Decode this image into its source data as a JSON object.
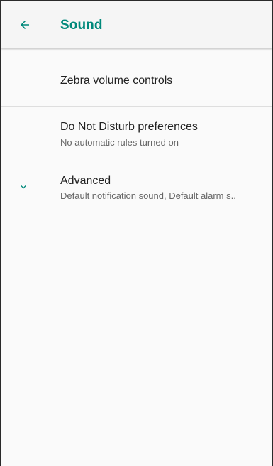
{
  "app_bar": {
    "title": "Sound",
    "back_icon": "arrow-back-icon",
    "accent_color": "#00897b"
  },
  "items": [
    {
      "title": "Zebra volume controls",
      "summary": ""
    },
    {
      "title": "Do Not Disturb preferences",
      "summary": "No automatic rules turned on"
    },
    {
      "title": "Advanced",
      "summary": "Default notification sound, Default alarm s..",
      "icon": "chevron-down-icon"
    }
  ]
}
